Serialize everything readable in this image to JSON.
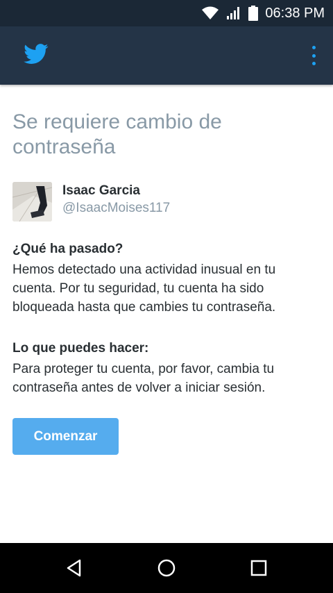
{
  "status_bar": {
    "time": "06:38 PM",
    "icons": [
      "wifi-icon",
      "signal-icon",
      "battery-icon"
    ]
  },
  "app_bar": {
    "logo": "twitter-bird-icon",
    "menu": "overflow-menu-icon",
    "accent_color": "#1da1f2"
  },
  "main": {
    "title": "Se requiere cambio de contraseña",
    "user": {
      "name": "Isaac Garcia",
      "handle": "@IsaacMoises117"
    },
    "what_happened": {
      "heading": "¿Qué ha pasado?",
      "body": "Hemos detectado una actividad inusual en tu cuenta. Por tu seguridad, tu cuenta ha sido bloqueada hasta que cambies tu contraseña."
    },
    "what_to_do": {
      "heading": "Lo que puedes hacer:",
      "body": "Para proteger tu cuenta, por favor, cambia tu contraseña antes de volver a iniciar sesión."
    },
    "button_label": "Comenzar",
    "button_color": "#55acee"
  },
  "nav_bar": {
    "buttons": [
      "back-icon",
      "home-icon",
      "recents-icon"
    ]
  }
}
